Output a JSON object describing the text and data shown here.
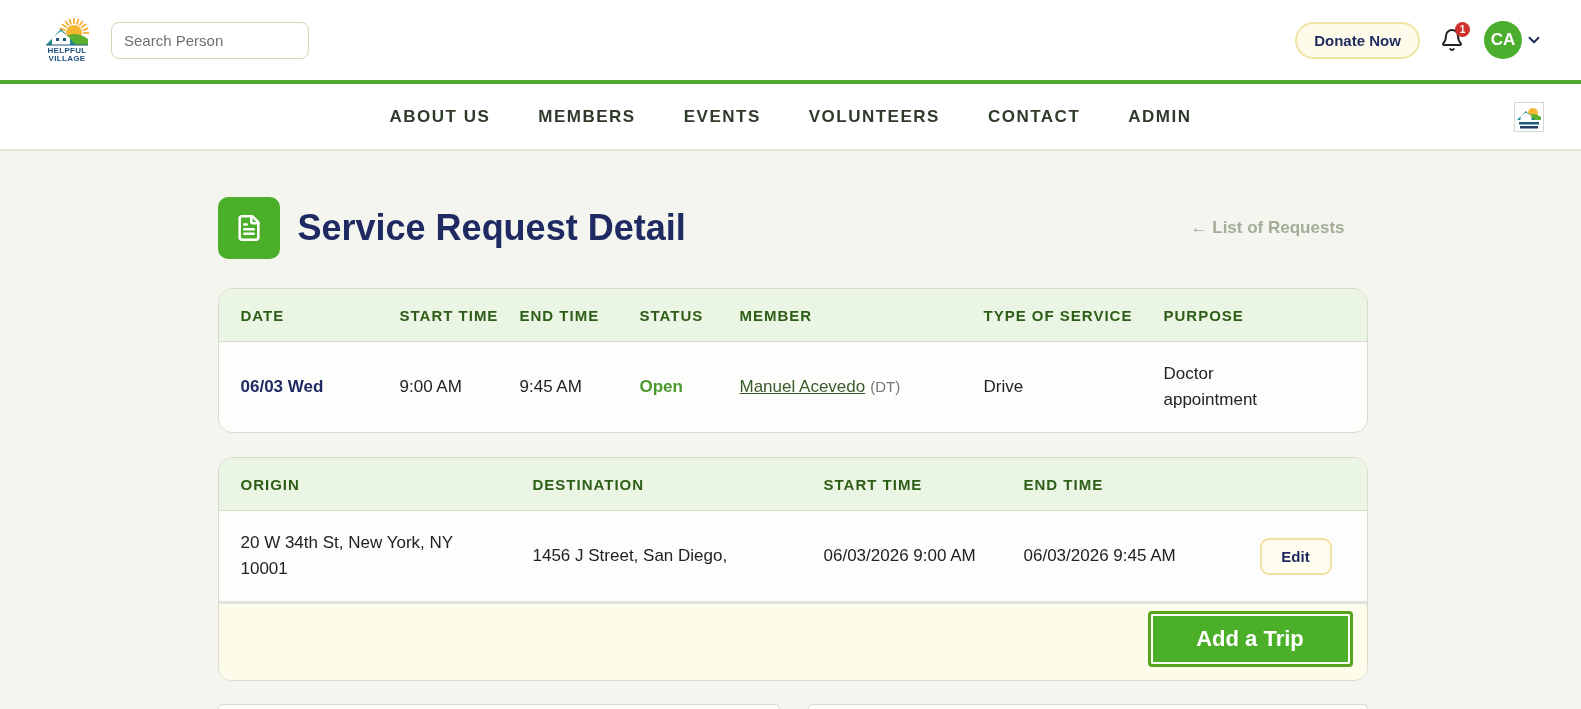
{
  "header": {
    "logo": {
      "lines": [
        "HELPFUL",
        "VILLAGE"
      ]
    },
    "search": {
      "placeholder": "Search Person"
    },
    "donate_button": "Donate Now",
    "notifications": {
      "badge": "1"
    },
    "account": {
      "initials": "CA"
    }
  },
  "nav": {
    "items": [
      {
        "label": "ABOUT US",
        "selected": false
      },
      {
        "label": "MEMBERS",
        "selected": false
      },
      {
        "label": "EVENTS",
        "selected": false
      },
      {
        "label": "VOLUNTEERS",
        "selected": false
      },
      {
        "label": "CONTACT",
        "selected": false
      },
      {
        "label": "ADMIN",
        "selected": false
      }
    ]
  },
  "page": {
    "title": "Service Request Detail",
    "back_link": "← List of Requests"
  },
  "request_table": {
    "columns": [
      "DATE",
      "START TIME",
      "END TIME",
      "STATUS",
      "MEMBER",
      "TYPE OF SERVICE",
      "PURPOSE"
    ],
    "rows": [
      {
        "cells": [
          {
            "kind": "date",
            "text": "06/03 Wed"
          },
          {
            "kind": "text",
            "text": "9:00 AM"
          },
          {
            "kind": "text",
            "text": "9:45 AM"
          },
          {
            "kind": "status",
            "text": "Open"
          },
          {
            "kind": "member",
            "text": "Manuel Acevedo",
            "note": "(DT)"
          },
          {
            "kind": "text",
            "text": "Drive"
          },
          {
            "kind": "text",
            "text": "Doctor appointment"
          }
        ]
      }
    ]
  },
  "trips_table": {
    "columns": [
      "ORIGIN",
      "DESTINATION",
      "START TIME",
      "END TIME"
    ],
    "rows": [
      {
        "cells": [
          {
            "kind": "text",
            "text": "20 W 34th St, New York, NY 10001"
          },
          {
            "kind": "text",
            "text": "1456 J Street, San Diego,"
          },
          {
            "kind": "text",
            "text": "06/03/2026 9:00 AM"
          },
          {
            "kind": "text",
            "text": "06/03/2026 9:45 AM"
          }
        ],
        "action": "Edit"
      }
    ],
    "add_button": {
      "label": "Add a Trip",
      "focused": true
    }
  }
}
